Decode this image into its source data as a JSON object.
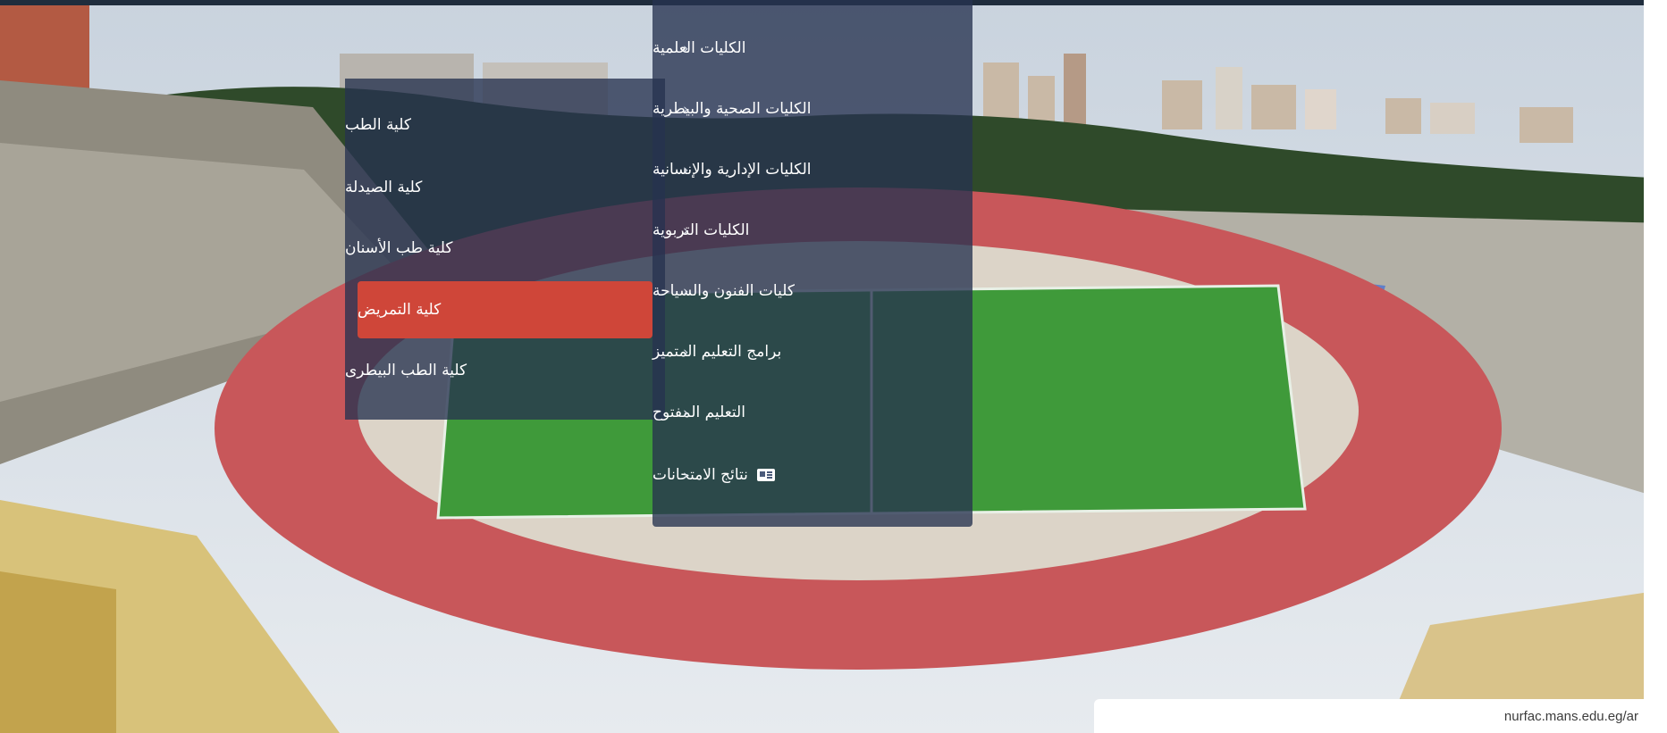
{
  "menu": {
    "items": [
      {
        "label": "الكليات العلمية"
      },
      {
        "label": "الكليات الصحية والبيطرية"
      },
      {
        "label": "الكليات الإدارية والإنسانية"
      },
      {
        "label": "الكليات التربوية"
      },
      {
        "label": "كليات الفنون والسياحة"
      },
      {
        "label": "برامج التعليم المتميز"
      },
      {
        "label": "التعليم المفتوح"
      },
      {
        "label": "نتائج الامتحانات"
      }
    ],
    "chevron": "‹"
  },
  "submenu": {
    "items": [
      {
        "label": "كلية الطب"
      },
      {
        "label": "كلية الصيدلة"
      },
      {
        "label": "كلية طب الأسنان"
      },
      {
        "label": "كلية التمريض"
      },
      {
        "label": "كلية الطب البيطرى"
      }
    ],
    "active_index": 3
  },
  "status_url": "nurfac.mans.edu.eg/ar",
  "colors": {
    "menu_bg": "#263250",
    "active": "#cf4639",
    "track": "#c8575a",
    "field": "#3f9a3a"
  },
  "icons": {
    "results": "newspaper-icon",
    "chevron": "chevron-left-icon"
  }
}
